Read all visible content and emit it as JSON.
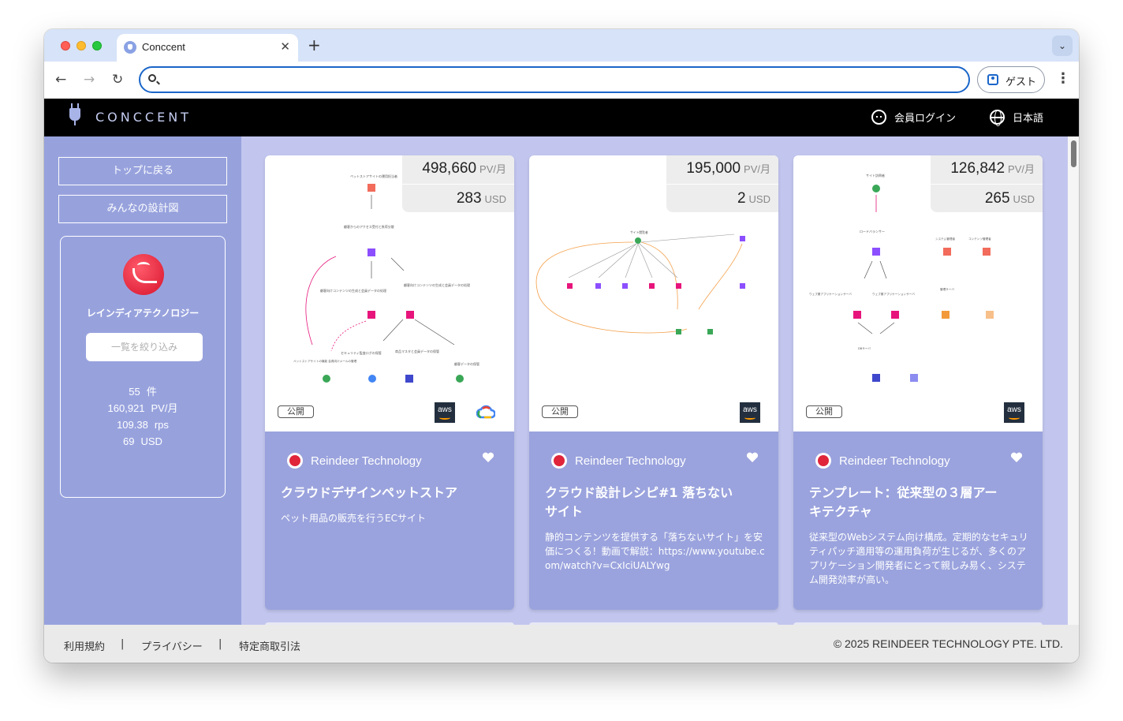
{
  "browser": {
    "tab_title": "Conccent",
    "tab_close": "✕",
    "new_tab": "+",
    "tab_menu": "⌄",
    "back": "←",
    "forward": "→",
    "reload": "↻",
    "address_value": "",
    "guest_label": "ゲスト",
    "menu": "⋮"
  },
  "header": {
    "logo_text": "CONCCENT",
    "login_label": "会員ログイン",
    "language_label": "日本語"
  },
  "sidebar": {
    "top_button": "トップに戻る",
    "designs_button": "みんなの設計図",
    "company_name": "レインディアテクノロジー",
    "filter_button": "一覧を絞り込み",
    "stats": [
      {
        "value": "55",
        "unit": "件"
      },
      {
        "value": "160,921",
        "unit": "PV/月"
      },
      {
        "value": "109.38",
        "unit": "rps"
      },
      {
        "value": "69",
        "unit": "USD"
      }
    ]
  },
  "cards": [
    {
      "pv": "498,660",
      "pv_unit": "PV/月",
      "cost": "283",
      "cost_unit": "USD",
      "visibility": "公開",
      "providers": [
        "aws",
        "google-cloud"
      ],
      "author": "Reindeer Technology",
      "title": "クラウドデザインペットストア",
      "description": "ペット用品の販売を行うECサイト",
      "diagram_labels": [
        "ペットストアサイトの運用担当者",
        "顧客からのアクセス受付と負荷分散",
        "顧客向けコンテンツの生成と会員データの処理",
        "顧客向けコンテンツの生成と会員データの処理",
        "セキュリティ監査ログの保管",
        "商品マスタと会員データの保管",
        "ペットストアサイトの機能 会員向けメールの管理",
        "顧客データの保管"
      ]
    },
    {
      "pv": "195,000",
      "pv_unit": "PV/月",
      "cost": "2",
      "cost_unit": "USD",
      "visibility": "公開",
      "providers": [
        "aws"
      ],
      "author": "Reindeer Technology",
      "title": "クラウド設計レシピ#1 落ちないサイト",
      "description": "静的コンテンツを提供する「落ちないサイト」を安価につくる！動画で解説：https://www.youtube.com/watch?v=CxIciUALYwg",
      "diagram_labels": [
        "サイト閲覧者"
      ]
    },
    {
      "pv": "126,842",
      "pv_unit": "PV/月",
      "cost": "265",
      "cost_unit": "USD",
      "visibility": "公開",
      "providers": [
        "aws"
      ],
      "author": "Reindeer Technology",
      "title": "テンプレート：従来型の３層アーキテクチャ",
      "description": "従来型のWebシステム向け構成。定期的なセキュリティパッチ適用等の運用負荷が生じるが、多くのアプリケーション開発者にとって親しみ易く、システム開発効率が高い。",
      "diagram_labels": [
        "サイト訪問者",
        "ロードバランサー",
        "システム管理者",
        "コンテンツ管理者",
        "ウェブ層アプリケーションサーバ",
        "ウェブ層アプリケーションサーバ",
        "管理サーバ",
        "DBサーバ"
      ]
    }
  ],
  "footer": {
    "terms": "利用規約",
    "privacy": "プライバシー",
    "commerce": "特定商取引法",
    "separator": "|",
    "copyright": "© 2025 REINDEER TECHNOLOGY PTE. LTD."
  },
  "colors": {
    "sidebar_bg": "#97a2dd",
    "content_bg": "#c2c6ee",
    "card_bottom": "#9aa3dd",
    "header_bg": "#000000",
    "address_focus": "#1a66c9"
  }
}
